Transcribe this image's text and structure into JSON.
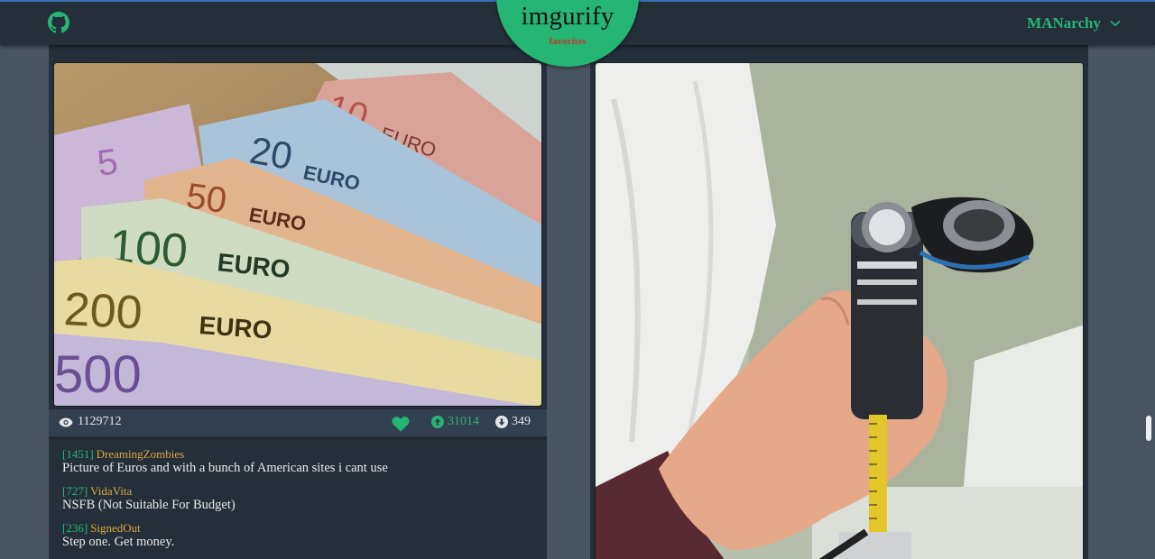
{
  "header": {
    "logo_title": "imgurify",
    "logo_subtitle": "favorites",
    "username": "MANarchy",
    "icons": [
      "github-icon",
      "chevron-down-icon"
    ]
  },
  "posts": [
    {
      "image_description_icon": "euro-banknotes-image",
      "views": "1129712",
      "favorited": true,
      "upvotes": "31014",
      "downvotes": "349",
      "comments": [
        {
          "points": "[1451]",
          "user": "DreamingZombies",
          "text": "Picture of Euros and with a bunch of American sites i cant use"
        },
        {
          "points": "[727]",
          "user": "VidaVita",
          "text": "NSFB (Not Suitable For Budget)"
        },
        {
          "points": "[236]",
          "user": "SignedOut",
          "text": "Step one. Get money."
        }
      ]
    },
    {
      "image_description_icon": "flashlight-shaver-image"
    }
  ],
  "colors": {
    "accent": "#25b574",
    "topbar": "#252f3a",
    "background": "#4a5562",
    "username_comment": "#d9a441",
    "subtitle": "#c0392b"
  }
}
